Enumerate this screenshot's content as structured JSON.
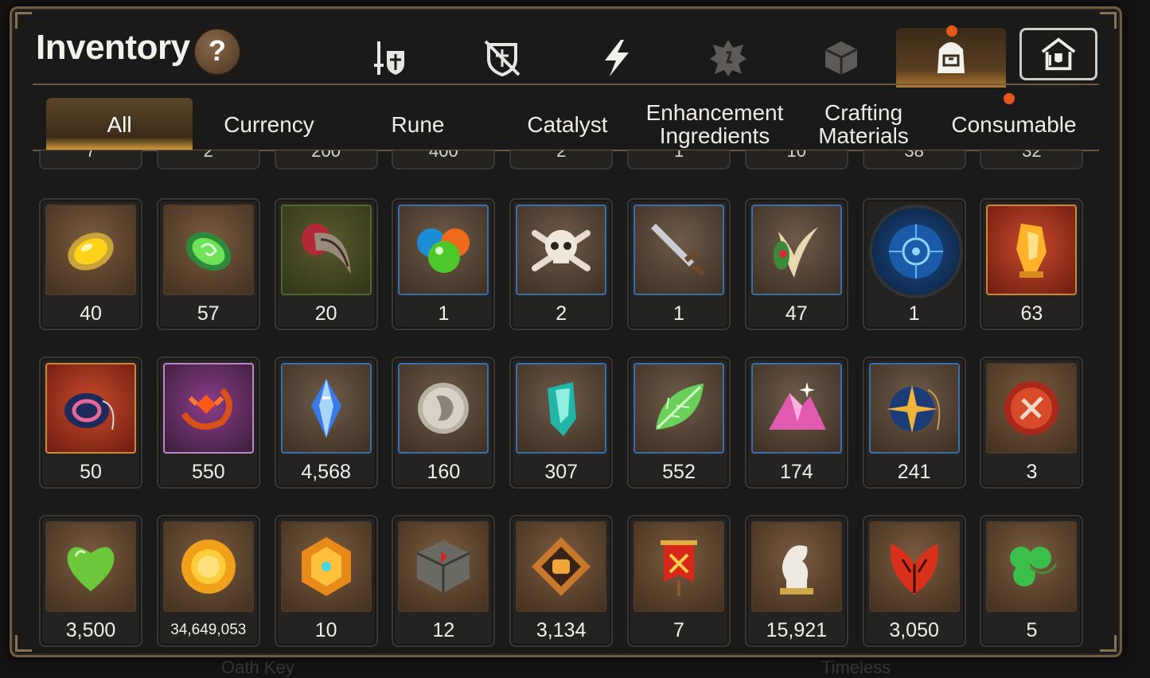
{
  "window": {
    "title": "Inventory",
    "help_label": "?"
  },
  "category_icons": [
    {
      "name": "equipment",
      "icon": "sword-shield-icon"
    },
    {
      "name": "artifact",
      "icon": "broken-shield-icon"
    },
    {
      "name": "skill",
      "icon": "lightning-icon"
    },
    {
      "name": "rune",
      "icon": "cracked-gem-icon"
    },
    {
      "name": "cube",
      "icon": "cube-icon"
    },
    {
      "name": "bag",
      "icon": "backpack-icon",
      "active": true,
      "badge": true
    },
    {
      "name": "home",
      "icon": "house-icon"
    }
  ],
  "tabs": [
    {
      "label": "All",
      "active": true
    },
    {
      "label": "Currency"
    },
    {
      "label": "Rune"
    },
    {
      "label": "Catalyst"
    },
    {
      "label": "Enhancement\nIngredients"
    },
    {
      "label": "Crafting\nMaterials"
    },
    {
      "label": "Consumable",
      "badge": true
    }
  ],
  "partial_row": [
    "7",
    "2",
    "200",
    "400",
    "2",
    "1",
    "10",
    "38",
    "32"
  ],
  "items": [
    {
      "name": "yellow-gem",
      "icon": "yellow-gem-icon",
      "qty": "40",
      "frame": "brown"
    },
    {
      "name": "green-gem",
      "icon": "green-gem-icon",
      "qty": "57",
      "frame": "brown"
    },
    {
      "name": "claw",
      "icon": "claw-icon",
      "qty": "20",
      "frame": "green"
    },
    {
      "name": "slime-orbs",
      "icon": "slime-orbs-icon",
      "qty": "1",
      "frame": "blue"
    },
    {
      "name": "skull-crossbones",
      "icon": "skull-icon",
      "qty": "2",
      "frame": "blue"
    },
    {
      "name": "dagger",
      "icon": "dagger-icon",
      "qty": "1",
      "frame": "blue"
    },
    {
      "name": "herb-root",
      "icon": "herb-icon",
      "qty": "47",
      "frame": "blue"
    },
    {
      "name": "rune-circle",
      "icon": "rune-circle-icon",
      "qty": "1",
      "frame": "round"
    },
    {
      "name": "amber-crystal",
      "icon": "amber-crystal-icon",
      "qty": "63",
      "frame": "red"
    },
    {
      "name": "loop-pendant",
      "icon": "pendant-icon",
      "qty": "50",
      "frame": "red"
    },
    {
      "name": "ring-emblem",
      "icon": "ring-emblem-icon",
      "qty": "550",
      "frame": "purple"
    },
    {
      "name": "blue-crystal",
      "icon": "blue-crystal-icon",
      "qty": "4,568",
      "frame": "blue"
    },
    {
      "name": "silver-coin",
      "icon": "coin-face-icon",
      "qty": "160",
      "frame": "blue"
    },
    {
      "name": "teal-crystal",
      "icon": "teal-crystal-icon",
      "qty": "307",
      "frame": "blue"
    },
    {
      "name": "green-leaf",
      "icon": "leaf-icon",
      "qty": "552",
      "frame": "blue"
    },
    {
      "name": "pink-dust",
      "icon": "pink-dust-icon",
      "qty": "174",
      "frame": "blue"
    },
    {
      "name": "star-pendant",
      "icon": "star-pendant-icon",
      "qty": "241",
      "frame": "blue"
    },
    {
      "name": "red-badge",
      "icon": "seal-badge-icon",
      "qty": "3",
      "frame": "brown"
    },
    {
      "name": "green-heart",
      "icon": "heart-icon",
      "qty": "3,500",
      "frame": "brown"
    },
    {
      "name": "gold-coin",
      "icon": "gold-coin-icon",
      "qty": "34,649,053",
      "frame": "brown",
      "small": true
    },
    {
      "name": "hex-emblem",
      "icon": "hex-emblem-icon",
      "qty": "10",
      "frame": "brown"
    },
    {
      "name": "stone-cube",
      "icon": "stone-cube-icon",
      "qty": "12",
      "frame": "brown"
    },
    {
      "name": "fist-emblem",
      "icon": "fist-emblem-icon",
      "qty": "3,134",
      "frame": "brown"
    },
    {
      "name": "war-banner",
      "icon": "banner-icon",
      "qty": "7",
      "frame": "brown"
    },
    {
      "name": "knight-piece",
      "icon": "knight-icon",
      "qty": "15,921",
      "frame": "brown"
    },
    {
      "name": "red-leaf",
      "icon": "red-leaf-icon",
      "qty": "3,050",
      "frame": "brown"
    },
    {
      "name": "clover",
      "icon": "clover-icon",
      "qty": "5",
      "frame": "brown"
    }
  ],
  "background_text": [
    "Oath Key",
    "Timeless"
  ]
}
